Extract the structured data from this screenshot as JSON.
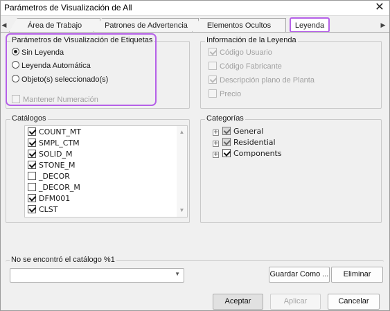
{
  "window": {
    "title": "Parámetros de Visualización de All"
  },
  "tabs": [
    {
      "label": "Área de Trabajo"
    },
    {
      "label": "Patrones de Advertencia"
    },
    {
      "label": "Elementos Ocultos"
    },
    {
      "label": "Leyenda"
    }
  ],
  "labels_group": {
    "title": "Parámetros de Visualización de Etiquetas",
    "options": [
      "Sin Leyenda",
      "Leyenda Automática",
      "Objeto(s) seleccionado(s)"
    ],
    "selected": "Sin Leyenda",
    "keep_numbering": "Mantener Numeración"
  },
  "legend_info": {
    "title": "Información de la Leyenda",
    "items": [
      {
        "label": "Código Usuario",
        "checked": true
      },
      {
        "label": "Código Fabricante",
        "checked": false
      },
      {
        "label": "Descripción plano de Planta",
        "checked": true
      },
      {
        "label": "Precio",
        "checked": false
      }
    ]
  },
  "catalogs": {
    "title": "Catálogos",
    "items": [
      {
        "label": "COUNT_MT",
        "checked": true
      },
      {
        "label": "SMPL_CTM",
        "checked": true
      },
      {
        "label": "SOLID_M",
        "checked": true
      },
      {
        "label": "STONE_M",
        "checked": true
      },
      {
        "label": "_DECOR",
        "checked": false
      },
      {
        "label": "_DECOR_M",
        "checked": false
      },
      {
        "label": "DFM001",
        "checked": true
      },
      {
        "label": "CLST",
        "checked": true
      }
    ]
  },
  "categories": {
    "title": "Categorías",
    "items": [
      {
        "label": "General",
        "checked": true
      },
      {
        "label": "Residential",
        "checked": true
      },
      {
        "label": "Components",
        "checked": true
      }
    ]
  },
  "missing_catalog": {
    "title": "No se encontró el catálogo %1",
    "combo_value": "",
    "save_as": "Guardar Como ...",
    "delete": "Eliminar"
  },
  "footer": {
    "accept": "Aceptar",
    "apply": "Aplicar",
    "cancel": "Cancelar"
  }
}
